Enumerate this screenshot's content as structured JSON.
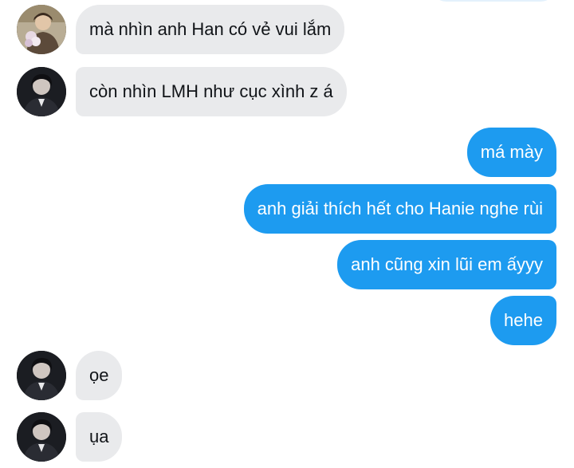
{
  "colors": {
    "outgoing_bubble": "#1d9bf0",
    "incoming_bubble": "#e9eaec",
    "incoming_text": "#111418",
    "outgoing_text": "#ffffff"
  },
  "messages": [
    {
      "direction": "incoming",
      "avatar": "contact-a",
      "text": "mà nhìn anh Han có vẻ vui lắm"
    },
    {
      "direction": "incoming",
      "avatar": "contact-b",
      "text": "còn nhìn LMH như cục xình z á"
    },
    {
      "direction": "outgoing",
      "text": "má mày"
    },
    {
      "direction": "outgoing",
      "text": "anh giải thích hết cho Hanie nghe rùi"
    },
    {
      "direction": "outgoing",
      "text": "anh cũng xin lũi em ấyyy"
    },
    {
      "direction": "outgoing",
      "text": "hehe"
    },
    {
      "direction": "incoming",
      "avatar": "contact-b",
      "text": "ọe"
    },
    {
      "direction": "incoming",
      "avatar": "contact-b",
      "text": "ụa"
    }
  ]
}
